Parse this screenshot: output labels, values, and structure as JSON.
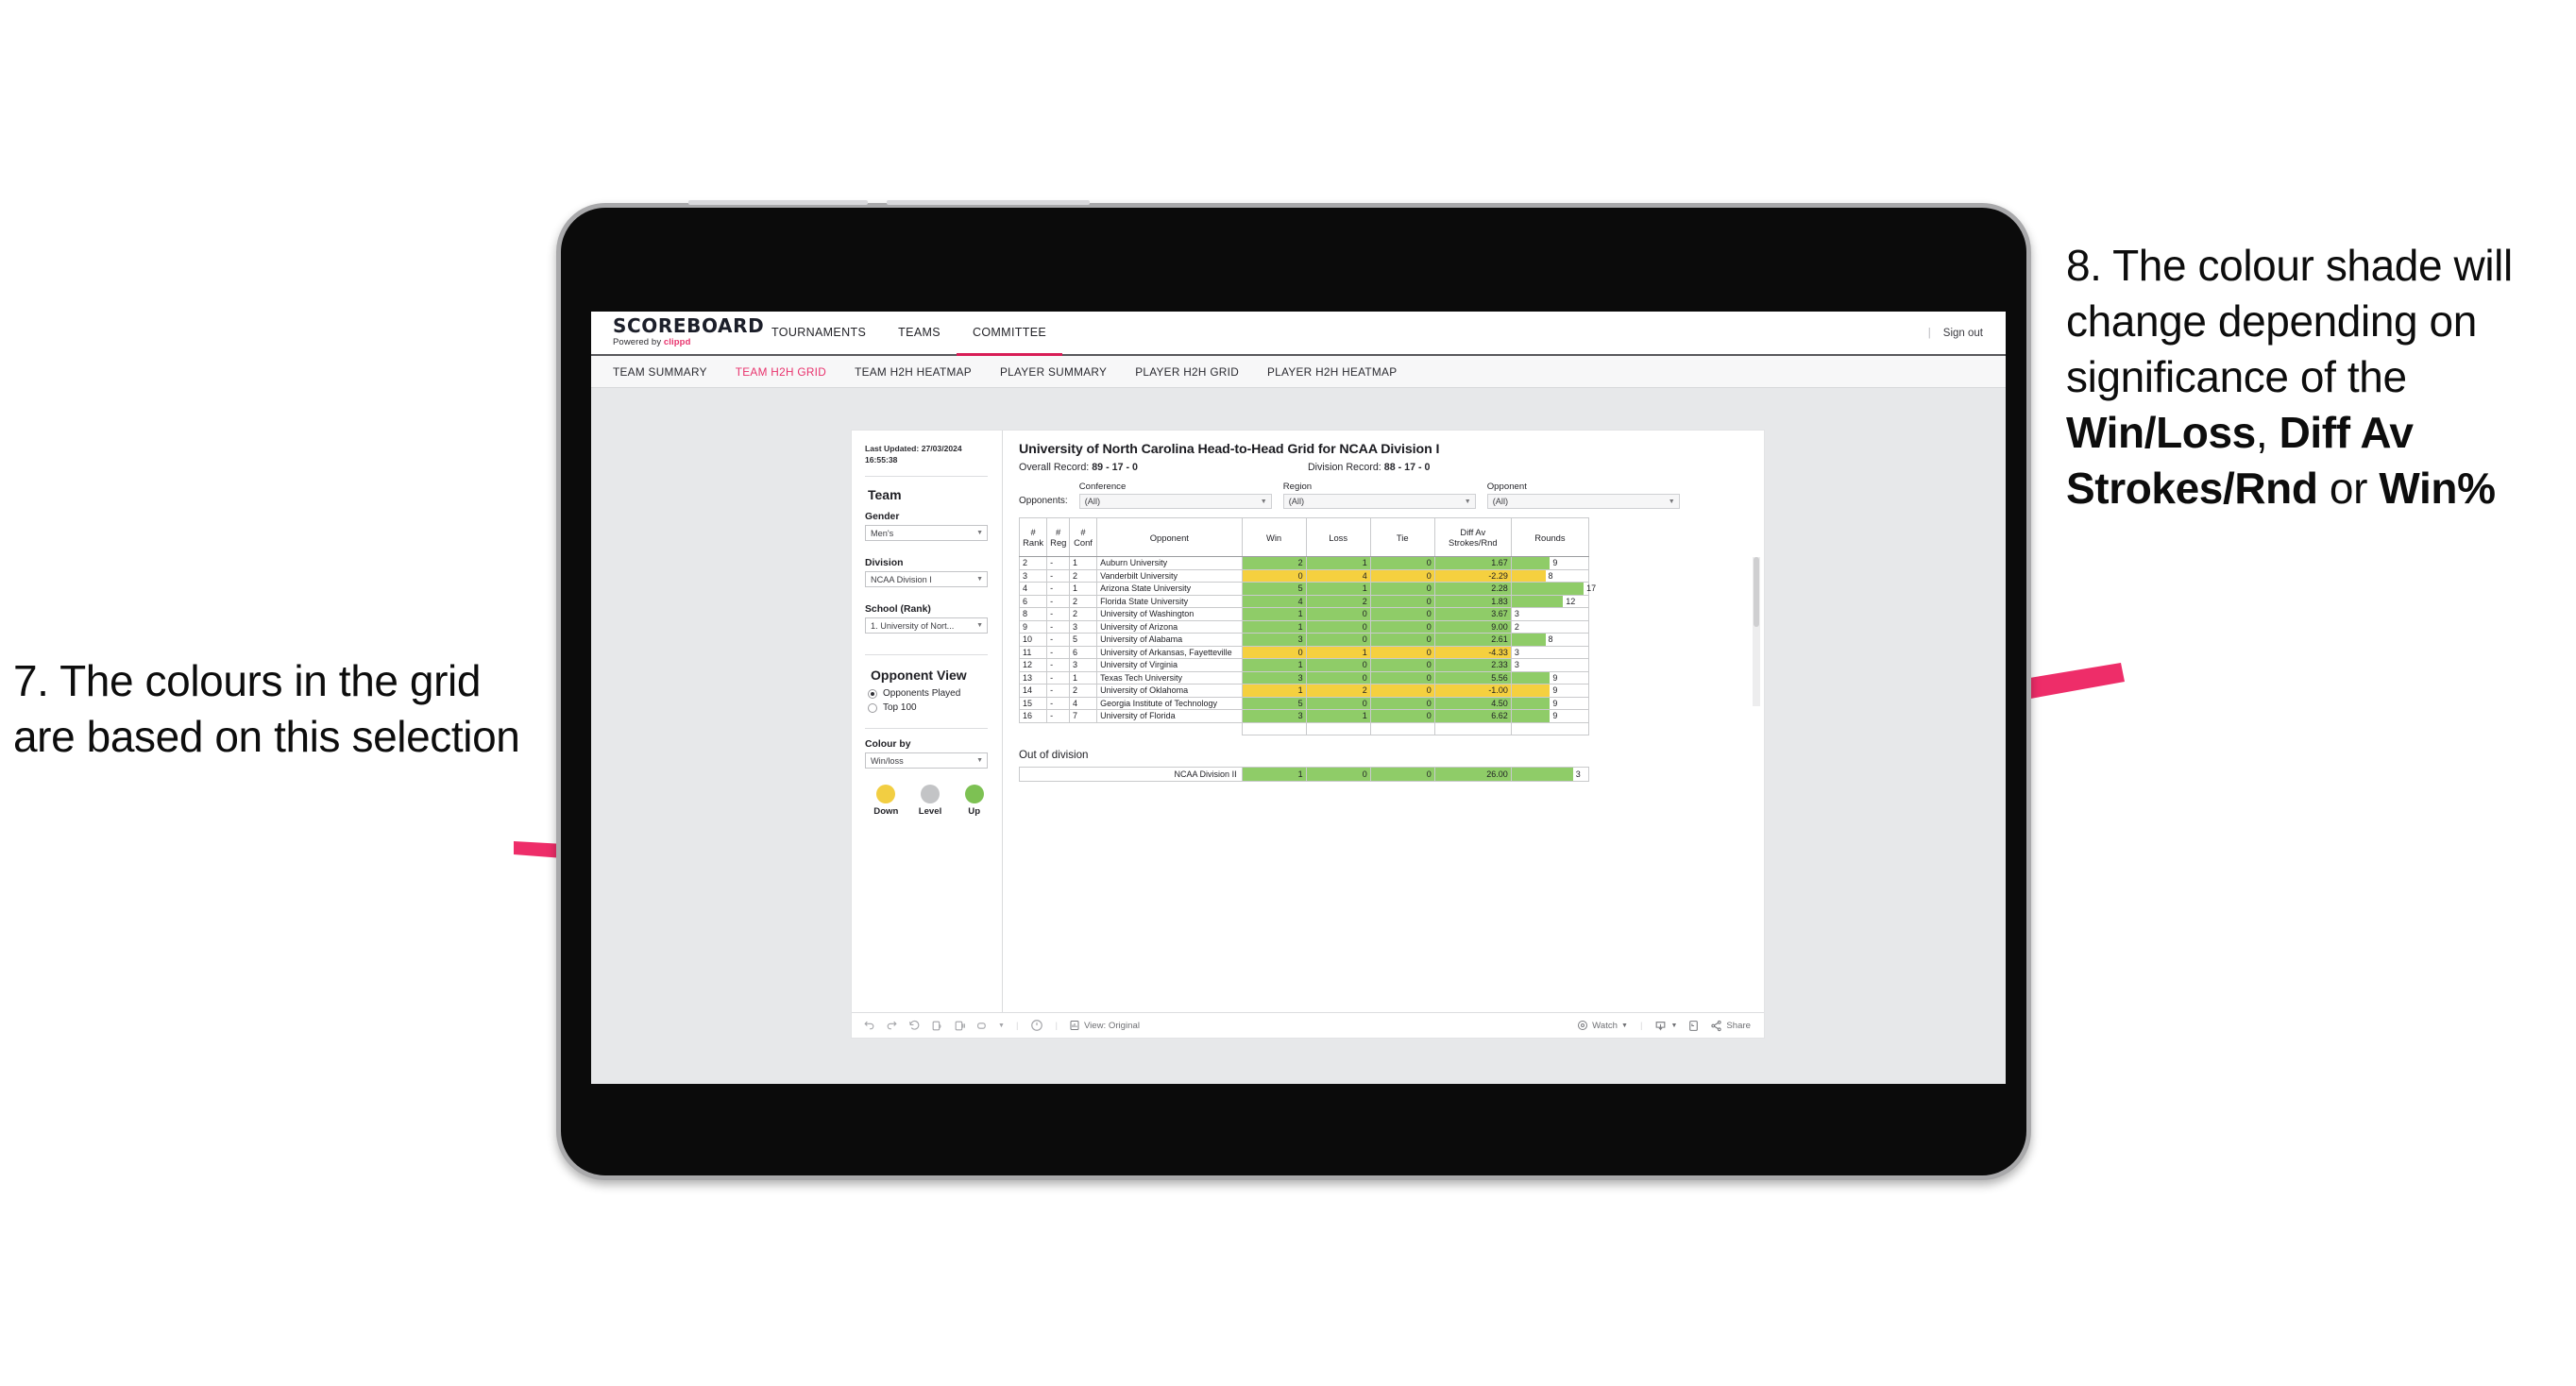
{
  "annotations": {
    "left": {
      "id": "7.",
      "text": "7. The colours in the grid are based on this selection"
    },
    "right": {
      "pre": "8. The colour shade will change depending on significance of the ",
      "b1": "Win/Loss",
      "mid1": ", ",
      "b2": "Diff Av Strokes/Rnd",
      "mid2": " or ",
      "b3": "Win%"
    },
    "arrow_color": "#ee2d69"
  },
  "app": {
    "brand": {
      "title": "SCOREBOARD",
      "powered": "Powered by",
      "clippd": "clippd"
    },
    "topnav": [
      {
        "label": "TOURNAMENTS",
        "active": false
      },
      {
        "label": "TEAMS",
        "active": false
      },
      {
        "label": "COMMITTEE",
        "active": true
      }
    ],
    "signout": {
      "divider": "|",
      "label": "Sign out"
    },
    "subnav": [
      {
        "label": "TEAM SUMMARY",
        "active": false
      },
      {
        "label": "TEAM H2H GRID",
        "active": true
      },
      {
        "label": "TEAM H2H HEATMAP",
        "active": false
      },
      {
        "label": "PLAYER SUMMARY",
        "active": false
      },
      {
        "label": "PLAYER H2H GRID",
        "active": false
      },
      {
        "label": "PLAYER H2H HEATMAP",
        "active": false
      }
    ]
  },
  "sidebar": {
    "last_updated_label": "Last Updated:",
    "last_updated_value": "27/03/2024 16:55:38",
    "team_heading": "Team",
    "gender_label": "Gender",
    "gender_value": "Men's",
    "division_label": "Division",
    "division_value": "NCAA Division I",
    "school_label": "School (Rank)",
    "school_value": "1. University of Nort...",
    "opponent_view_heading": "Opponent View",
    "opponent_view_options": [
      {
        "label": "Opponents Played",
        "selected": true
      },
      {
        "label": "Top 100",
        "selected": false
      }
    ],
    "colour_by_label": "Colour by",
    "colour_by_value": "Win/loss",
    "legend": [
      {
        "label": "Down",
        "color": "#f2ce42"
      },
      {
        "label": "Level",
        "color": "#c3c4c6"
      },
      {
        "label": "Up",
        "color": "#7dc153"
      }
    ]
  },
  "viz": {
    "title": "University of North Carolina Head-to-Head Grid for NCAA Division I",
    "overall_label": "Overall Record:",
    "overall_value": "89 - 17 - 0",
    "division_label": "Division Record:",
    "division_value": "88 - 17 - 0",
    "opponents_label": "Opponents:",
    "filters": [
      {
        "label": "Conference",
        "value": "(All)"
      },
      {
        "label": "Region",
        "value": "(All)"
      },
      {
        "label": "Opponent",
        "value": "(All)"
      }
    ],
    "columns": [
      {
        "l1": "#",
        "l2": "Rank"
      },
      {
        "l1": "#",
        "l2": "Reg"
      },
      {
        "l1": "#",
        "l2": "Conf"
      },
      {
        "l1": "Opponent",
        "l2": ""
      },
      {
        "l1": "Win",
        "l2": ""
      },
      {
        "l1": "Loss",
        "l2": ""
      },
      {
        "l1": "Tie",
        "l2": ""
      },
      {
        "l1": "Diff Av",
        "l2": "Strokes/Rnd"
      },
      {
        "l1": "Rounds",
        "l2": ""
      }
    ],
    "out_of_division_heading": "Out of division",
    "out_of_division_row": {
      "name": "NCAA Division II",
      "win": "1",
      "loss": "0",
      "tie": "0",
      "diff": "26.00",
      "rounds": "3",
      "state": "up",
      "rounds_pct": 80
    },
    "toolbar": {
      "view_label": "View: Original",
      "watch_label": "Watch",
      "share_label": "Share"
    }
  },
  "chart_data": {
    "type": "table",
    "title": "University of North Carolina Head-to-Head Grid for NCAA Division I",
    "columns": [
      "# Rank",
      "# Reg",
      "# Conf",
      "Opponent",
      "Win",
      "Loss",
      "Tie",
      "Diff Av Strokes/Rnd",
      "Rounds"
    ],
    "rows": [
      {
        "rank": "2",
        "reg": "-",
        "conf": "1",
        "opponent": "Auburn University",
        "win": "2",
        "loss": "1",
        "tie": "0",
        "diff": "1.67",
        "rounds": "9",
        "state": "up",
        "rounds_pct": 50
      },
      {
        "rank": "3",
        "reg": "-",
        "conf": "2",
        "opponent": "Vanderbilt University",
        "win": "0",
        "loss": "4",
        "tie": "0",
        "diff": "-2.29",
        "rounds": "8",
        "state": "down",
        "rounds_pct": 44
      },
      {
        "rank": "4",
        "reg": "-",
        "conf": "1",
        "opponent": "Arizona State University",
        "win": "5",
        "loss": "1",
        "tie": "0",
        "diff": "2.28",
        "rounds": "17",
        "state": "up",
        "rounds_pct": 94
      },
      {
        "rank": "6",
        "reg": "-",
        "conf": "2",
        "opponent": "Florida State University",
        "win": "4",
        "loss": "2",
        "tie": "0",
        "diff": "1.83",
        "rounds": "12",
        "state": "up",
        "rounds_pct": 67
      },
      {
        "rank": "8",
        "reg": "-",
        "conf": "2",
        "opponent": "University of Washington",
        "win": "1",
        "loss": "0",
        "tie": "0",
        "diff": "3.67",
        "rounds": "3",
        "state": "up",
        "rounds_pct": 0
      },
      {
        "rank": "9",
        "reg": "-",
        "conf": "3",
        "opponent": "University of Arizona",
        "win": "1",
        "loss": "0",
        "tie": "0",
        "diff": "9.00",
        "rounds": "2",
        "state": "up",
        "rounds_pct": 0
      },
      {
        "rank": "10",
        "reg": "-",
        "conf": "5",
        "opponent": "University of Alabama",
        "win": "3",
        "loss": "0",
        "tie": "0",
        "diff": "2.61",
        "rounds": "8",
        "state": "up",
        "rounds_pct": 44
      },
      {
        "rank": "11",
        "reg": "-",
        "conf": "6",
        "opponent": "University of Arkansas, Fayetteville",
        "win": "0",
        "loss": "1",
        "tie": "0",
        "diff": "-4.33",
        "rounds": "3",
        "state": "down",
        "rounds_pct": 0
      },
      {
        "rank": "12",
        "reg": "-",
        "conf": "3",
        "opponent": "University of Virginia",
        "win": "1",
        "loss": "0",
        "tie": "0",
        "diff": "2.33",
        "rounds": "3",
        "state": "up",
        "rounds_pct": 0
      },
      {
        "rank": "13",
        "reg": "-",
        "conf": "1",
        "opponent": "Texas Tech University",
        "win": "3",
        "loss": "0",
        "tie": "0",
        "diff": "5.56",
        "rounds": "9",
        "state": "up",
        "rounds_pct": 50
      },
      {
        "rank": "14",
        "reg": "-",
        "conf": "2",
        "opponent": "University of Oklahoma",
        "win": "1",
        "loss": "2",
        "tie": "0",
        "diff": "-1.00",
        "rounds": "9",
        "state": "down",
        "rounds_pct": 50
      },
      {
        "rank": "15",
        "reg": "-",
        "conf": "4",
        "opponent": "Georgia Institute of Technology",
        "win": "5",
        "loss": "0",
        "tie": "0",
        "diff": "4.50",
        "rounds": "9",
        "state": "up",
        "rounds_pct": 50
      },
      {
        "rank": "16",
        "reg": "-",
        "conf": "7",
        "opponent": "University of Florida",
        "win": "3",
        "loss": "1",
        "tie": "0",
        "diff": "6.62",
        "rounds": "9",
        "state": "up",
        "rounds_pct": 50
      }
    ],
    "color_legend": {
      "up": "#8fcc68",
      "down": "#f5d03f",
      "level": "#c3c4c6"
    }
  }
}
